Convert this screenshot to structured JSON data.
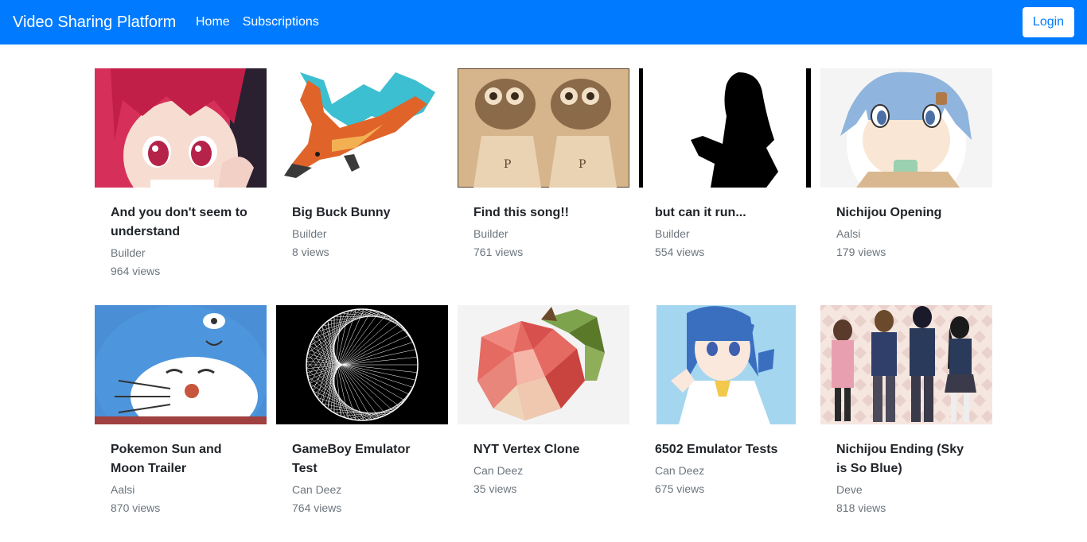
{
  "navbar": {
    "brand": "Video Sharing Platform",
    "links": [
      "Home",
      "Subscriptions"
    ],
    "login": "Login"
  },
  "videos": [
    {
      "title": "And you don't seem to understand",
      "author": "Builder",
      "views": "964 views"
    },
    {
      "title": "Big Buck Bunny",
      "author": "Builder",
      "views": "8 views"
    },
    {
      "title": "Find this song!!",
      "author": "Builder",
      "views": "761 views"
    },
    {
      "title": "but can it run...",
      "author": "Builder",
      "views": "554 views"
    },
    {
      "title": "Nichijou Opening",
      "author": "Aalsi",
      "views": "179 views"
    },
    {
      "title": "Pokemon Sun and Moon Trailer",
      "author": "Aalsi",
      "views": "870 views"
    },
    {
      "title": "GameBoy Emulator Test",
      "author": "Can Deez",
      "views": "764 views"
    },
    {
      "title": "NYT Vertex Clone",
      "author": "Can Deez",
      "views": "35 views"
    },
    {
      "title": "6502 Emulator Tests",
      "author": "Can Deez",
      "views": "675 views"
    },
    {
      "title": "Nichijou Ending (Sky is So Blue)",
      "author": "Deve",
      "views": "818 views"
    }
  ]
}
